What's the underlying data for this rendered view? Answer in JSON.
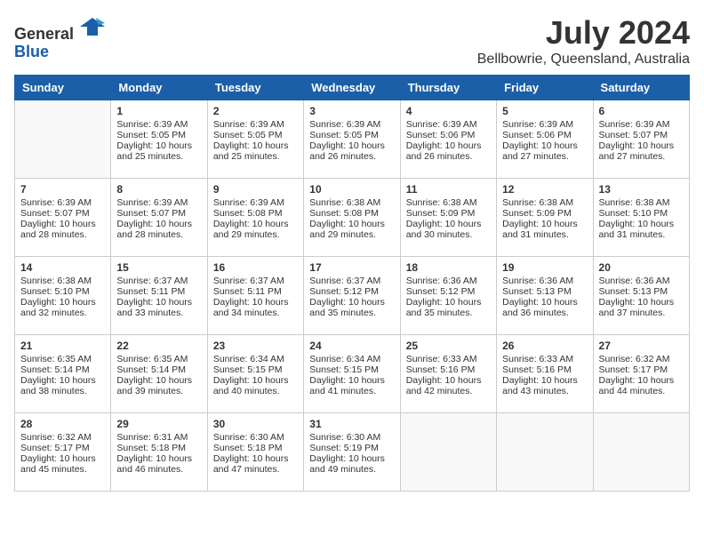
{
  "header": {
    "logo_line1": "General",
    "logo_line2": "Blue",
    "title": "July 2024",
    "subtitle": "Bellbowrie, Queensland, Australia"
  },
  "calendar": {
    "days_of_week": [
      "Sunday",
      "Monday",
      "Tuesday",
      "Wednesday",
      "Thursday",
      "Friday",
      "Saturday"
    ],
    "weeks": [
      [
        {
          "day": null,
          "data": null
        },
        {
          "day": "1",
          "sunrise": "6:39 AM",
          "sunset": "5:05 PM",
          "daylight": "10 hours and 25 minutes."
        },
        {
          "day": "2",
          "sunrise": "6:39 AM",
          "sunset": "5:05 PM",
          "daylight": "10 hours and 25 minutes."
        },
        {
          "day": "3",
          "sunrise": "6:39 AM",
          "sunset": "5:05 PM",
          "daylight": "10 hours and 26 minutes."
        },
        {
          "day": "4",
          "sunrise": "6:39 AM",
          "sunset": "5:06 PM",
          "daylight": "10 hours and 26 minutes."
        },
        {
          "day": "5",
          "sunrise": "6:39 AM",
          "sunset": "5:06 PM",
          "daylight": "10 hours and 27 minutes."
        },
        {
          "day": "6",
          "sunrise": "6:39 AM",
          "sunset": "5:07 PM",
          "daylight": "10 hours and 27 minutes."
        }
      ],
      [
        {
          "day": "7",
          "sunrise": "6:39 AM",
          "sunset": "5:07 PM",
          "daylight": "10 hours and 28 minutes."
        },
        {
          "day": "8",
          "sunrise": "6:39 AM",
          "sunset": "5:07 PM",
          "daylight": "10 hours and 28 minutes."
        },
        {
          "day": "9",
          "sunrise": "6:39 AM",
          "sunset": "5:08 PM",
          "daylight": "10 hours and 29 minutes."
        },
        {
          "day": "10",
          "sunrise": "6:38 AM",
          "sunset": "5:08 PM",
          "daylight": "10 hours and 29 minutes."
        },
        {
          "day": "11",
          "sunrise": "6:38 AM",
          "sunset": "5:09 PM",
          "daylight": "10 hours and 30 minutes."
        },
        {
          "day": "12",
          "sunrise": "6:38 AM",
          "sunset": "5:09 PM",
          "daylight": "10 hours and 31 minutes."
        },
        {
          "day": "13",
          "sunrise": "6:38 AM",
          "sunset": "5:10 PM",
          "daylight": "10 hours and 31 minutes."
        }
      ],
      [
        {
          "day": "14",
          "sunrise": "6:38 AM",
          "sunset": "5:10 PM",
          "daylight": "10 hours and 32 minutes."
        },
        {
          "day": "15",
          "sunrise": "6:37 AM",
          "sunset": "5:11 PM",
          "daylight": "10 hours and 33 minutes."
        },
        {
          "day": "16",
          "sunrise": "6:37 AM",
          "sunset": "5:11 PM",
          "daylight": "10 hours and 34 minutes."
        },
        {
          "day": "17",
          "sunrise": "6:37 AM",
          "sunset": "5:12 PM",
          "daylight": "10 hours and 35 minutes."
        },
        {
          "day": "18",
          "sunrise": "6:36 AM",
          "sunset": "5:12 PM",
          "daylight": "10 hours and 35 minutes."
        },
        {
          "day": "19",
          "sunrise": "6:36 AM",
          "sunset": "5:13 PM",
          "daylight": "10 hours and 36 minutes."
        },
        {
          "day": "20",
          "sunrise": "6:36 AM",
          "sunset": "5:13 PM",
          "daylight": "10 hours and 37 minutes."
        }
      ],
      [
        {
          "day": "21",
          "sunrise": "6:35 AM",
          "sunset": "5:14 PM",
          "daylight": "10 hours and 38 minutes."
        },
        {
          "day": "22",
          "sunrise": "6:35 AM",
          "sunset": "5:14 PM",
          "daylight": "10 hours and 39 minutes."
        },
        {
          "day": "23",
          "sunrise": "6:34 AM",
          "sunset": "5:15 PM",
          "daylight": "10 hours and 40 minutes."
        },
        {
          "day": "24",
          "sunrise": "6:34 AM",
          "sunset": "5:15 PM",
          "daylight": "10 hours and 41 minutes."
        },
        {
          "day": "25",
          "sunrise": "6:33 AM",
          "sunset": "5:16 PM",
          "daylight": "10 hours and 42 minutes."
        },
        {
          "day": "26",
          "sunrise": "6:33 AM",
          "sunset": "5:16 PM",
          "daylight": "10 hours and 43 minutes."
        },
        {
          "day": "27",
          "sunrise": "6:32 AM",
          "sunset": "5:17 PM",
          "daylight": "10 hours and 44 minutes."
        }
      ],
      [
        {
          "day": "28",
          "sunrise": "6:32 AM",
          "sunset": "5:17 PM",
          "daylight": "10 hours and 45 minutes."
        },
        {
          "day": "29",
          "sunrise": "6:31 AM",
          "sunset": "5:18 PM",
          "daylight": "10 hours and 46 minutes."
        },
        {
          "day": "30",
          "sunrise": "6:30 AM",
          "sunset": "5:18 PM",
          "daylight": "10 hours and 47 minutes."
        },
        {
          "day": "31",
          "sunrise": "6:30 AM",
          "sunset": "5:19 PM",
          "daylight": "10 hours and 49 minutes."
        },
        {
          "day": null,
          "data": null
        },
        {
          "day": null,
          "data": null
        },
        {
          "day": null,
          "data": null
        }
      ]
    ]
  }
}
